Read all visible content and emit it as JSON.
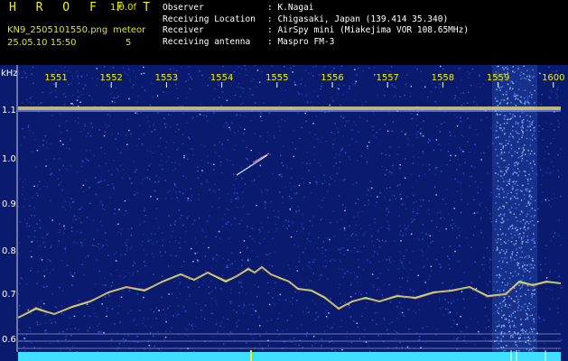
{
  "header": {
    "brand": "H R O F F T",
    "version": "1.0.0f",
    "filename": "KN9_2505101550.png",
    "meteor_label": "meteor",
    "timestamp": "25.05.10 15:50",
    "meteor_count": "5"
  },
  "observation": [
    {
      "key": "Observer",
      "value": ": K.Nagai"
    },
    {
      "key": "Receiving Location",
      "value": ": Chigasaki, Japan (139.414 35.340)"
    },
    {
      "key": "Receiver",
      "value": ": AirSpy mini (Miakejima VOR 108.65MHz)"
    },
    {
      "key": "Receiving antenna",
      "value": ": Maspro FM-3"
    }
  ],
  "spectrogram": {
    "y_unit": "kHz",
    "x_ticks": [
      "1551",
      "1552",
      "1553",
      "1554",
      "1555",
      "1556",
      "1557",
      "1558",
      "1559",
      "1600"
    ],
    "y_ticks": [
      "1.1",
      "1.0",
      "0.9",
      "0.8",
      "0.7",
      "0.6"
    ],
    "colors": {
      "background": "#0a1a6e",
      "tick_text": "#f2f200",
      "axis_text": "#ffffff",
      "baseline": "#3fe0ff"
    }
  }
}
